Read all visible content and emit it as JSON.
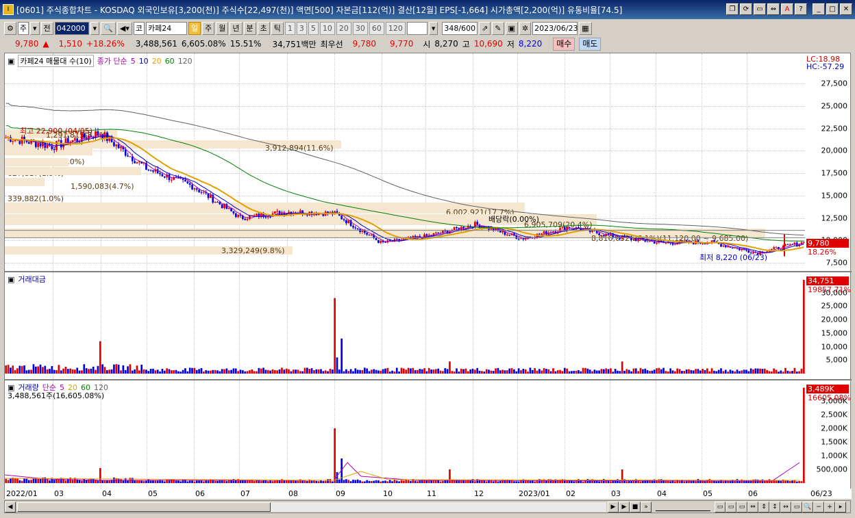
{
  "window": {
    "title": "[0601] 주식종합차트 - KOSDAQ 외국인보유[3,200(천)] 주식수[22,497(천)] 액면[500] 자본금[112(억)] 결산[12월] EPS[-1,664] 시가총액[2,200(억)] 유통비율[74.5]",
    "buttons": [
      "❐",
      "⟳",
      "▭",
      "⇔",
      "A",
      "?",
      "_",
      "□",
      "✕"
    ]
  },
  "toolbar": {
    "period_type": "주",
    "prev_label": "전",
    "code": "042000",
    "market": "코",
    "name": "카페24",
    "periods": [
      "일",
      "주",
      "월",
      "년",
      "분",
      "초",
      "틱"
    ],
    "selected_period": "일",
    "intervals": [
      "1",
      "3",
      "5",
      "10",
      "20",
      "30",
      "60",
      "120"
    ],
    "count": "348",
    "count_total": "/600",
    "date": "2023/06/23"
  },
  "quote": {
    "price": "9,780",
    "arrow": "▲",
    "change": "1,510",
    "change_pct": "+18.26%",
    "volume": "3,488,561",
    "volume_pct": "6,605.08%",
    "turnover": "15.51%",
    "amount": "34,751백만",
    "best_ask_label": "최우선",
    "best_ask": "9,780",
    "best_bid": "9,770",
    "open_label": "시",
    "open": "8,270",
    "high_label": "고",
    "high": "10,690",
    "low_label": "저",
    "low": "8,220",
    "buy_label": "매수",
    "sell_label": "매도"
  },
  "price_pane": {
    "title": "카페24 매물대 수(10)",
    "ma_label": "종가 단순",
    "ma_periods": [
      "5",
      "10",
      "20",
      "60",
      "120"
    ],
    "ma_colors": [
      "#b000b0",
      "#0000c0",
      "#e0a000",
      "#008000",
      "#606060"
    ],
    "lc": "LC:18.98",
    "hc": "HC:-57.29",
    "y_ticks": [
      "27,500",
      "25,000",
      "22,500",
      "20,000",
      "17,500",
      "15,000",
      "12,500",
      "10,000",
      "7,500"
    ],
    "current_tag": "9,780",
    "current_pct": "18.26%",
    "high_note": "최고 22,900 (04/05)",
    "low_note": "최저 8,220 (06/23)",
    "event_note": "배당락(0.00%)",
    "volume_profile": [
      {
        "label": "3,912,894(11.6%)",
        "width": 0.42
      },
      {
        "label": "1,291,815(3.8%)",
        "width": 0.14
      },
      {
        "label": "1,007,823(3.0%)",
        "width": 0.11
      },
      {
        "label": "627,817(1.9%)",
        "width": 0.08
      },
      {
        "label": "1,590,083(4.7%)",
        "width": 0.17
      },
      {
        "label": "339,882(1.0%)",
        "width": 0.05
      },
      {
        "label": "6,002,921(17.7%)",
        "width": 0.65
      },
      {
        "label": "6,905,709(20.4%)",
        "width": 0.74
      },
      {
        "label": "8,816,032(26.1%)(11,120.00 ~ 9,685.00)",
        "width": 0.95
      },
      {
        "label": "3,329,249(9.8%)",
        "width": 0.36
      }
    ]
  },
  "amount_pane": {
    "title": "거래대금",
    "y_ticks": [
      "30,000",
      "25,000",
      "20,000",
      "15,000",
      "10,000",
      "5,000"
    ],
    "tag_value": "34,751",
    "tag_avg": "19857.71%"
  },
  "volume_pane": {
    "title": "거래량",
    "ma_label": "단순",
    "ma_periods": [
      "5",
      "20",
      "60",
      "120"
    ],
    "summary": "3,488,561주(16,605.08%)",
    "y_ticks": [
      "3,000K",
      "2,500K",
      "2,000K",
      "1,500K",
      "1,000K",
      "500,000"
    ],
    "tag_value": "3,489K",
    "tag_avg": "16605.08%"
  },
  "x_axis": [
    "2022/01",
    "03",
    "04",
    "05",
    "06",
    "07",
    "08",
    "09",
    "10",
    "11",
    "12",
    "2023/01",
    "02",
    "03",
    "04",
    "05",
    "06",
    "06/23"
  ],
  "colors": {
    "up": "#e00000",
    "down": "#0000e0",
    "profile": "#f5e6d0",
    "ma5": "#b000b0",
    "ma10": "#0000c0",
    "ma20": "#e0a000",
    "ma60": "#008000",
    "ma120": "#606060"
  },
  "chart_data": {
    "type": "candlestick",
    "x_range": [
      "2022/01",
      "2023/06/23"
    ],
    "ylim": [
      7500,
      28500
    ],
    "close_points": [
      {
        "x": "2022/01",
        "y": 21500
      },
      {
        "x": "03",
        "y": 20500
      },
      {
        "x": "04",
        "y": 22000
      },
      {
        "x": "05",
        "y": 18000
      },
      {
        "x": "06",
        "y": 16000
      },
      {
        "x": "07",
        "y": 12500
      },
      {
        "x": "08",
        "y": 13200
      },
      {
        "x": "09",
        "y": 13000
      },
      {
        "x": "10",
        "y": 9700
      },
      {
        "x": "11",
        "y": 10500
      },
      {
        "x": "12",
        "y": 11800
      },
      {
        "x": "2023/01",
        "y": 10200
      },
      {
        "x": "02",
        "y": 11500
      },
      {
        "x": "03",
        "y": 10400
      },
      {
        "x": "04",
        "y": 9700
      },
      {
        "x": "05",
        "y": 9800
      },
      {
        "x": "06",
        "y": 8600
      },
      {
        "x": "06/23",
        "y": 9780
      }
    ],
    "amount_peaks_million": [
      {
        "x": "04",
        "y": 12000
      },
      {
        "x": "09",
        "y": 28000
      },
      {
        "x": "12",
        "y": 4500
      },
      {
        "x": "03",
        "y": 4500
      },
      {
        "x": "06/23",
        "y": 34751
      }
    ],
    "volume_peaks": [
      {
        "x": "04",
        "y": 550000
      },
      {
        "x": "09",
        "y": 2000000
      },
      {
        "x": "12",
        "y": 500000
      },
      {
        "x": "03",
        "y": 500000
      },
      {
        "x": "06/23",
        "y": 3488561
      }
    ]
  }
}
